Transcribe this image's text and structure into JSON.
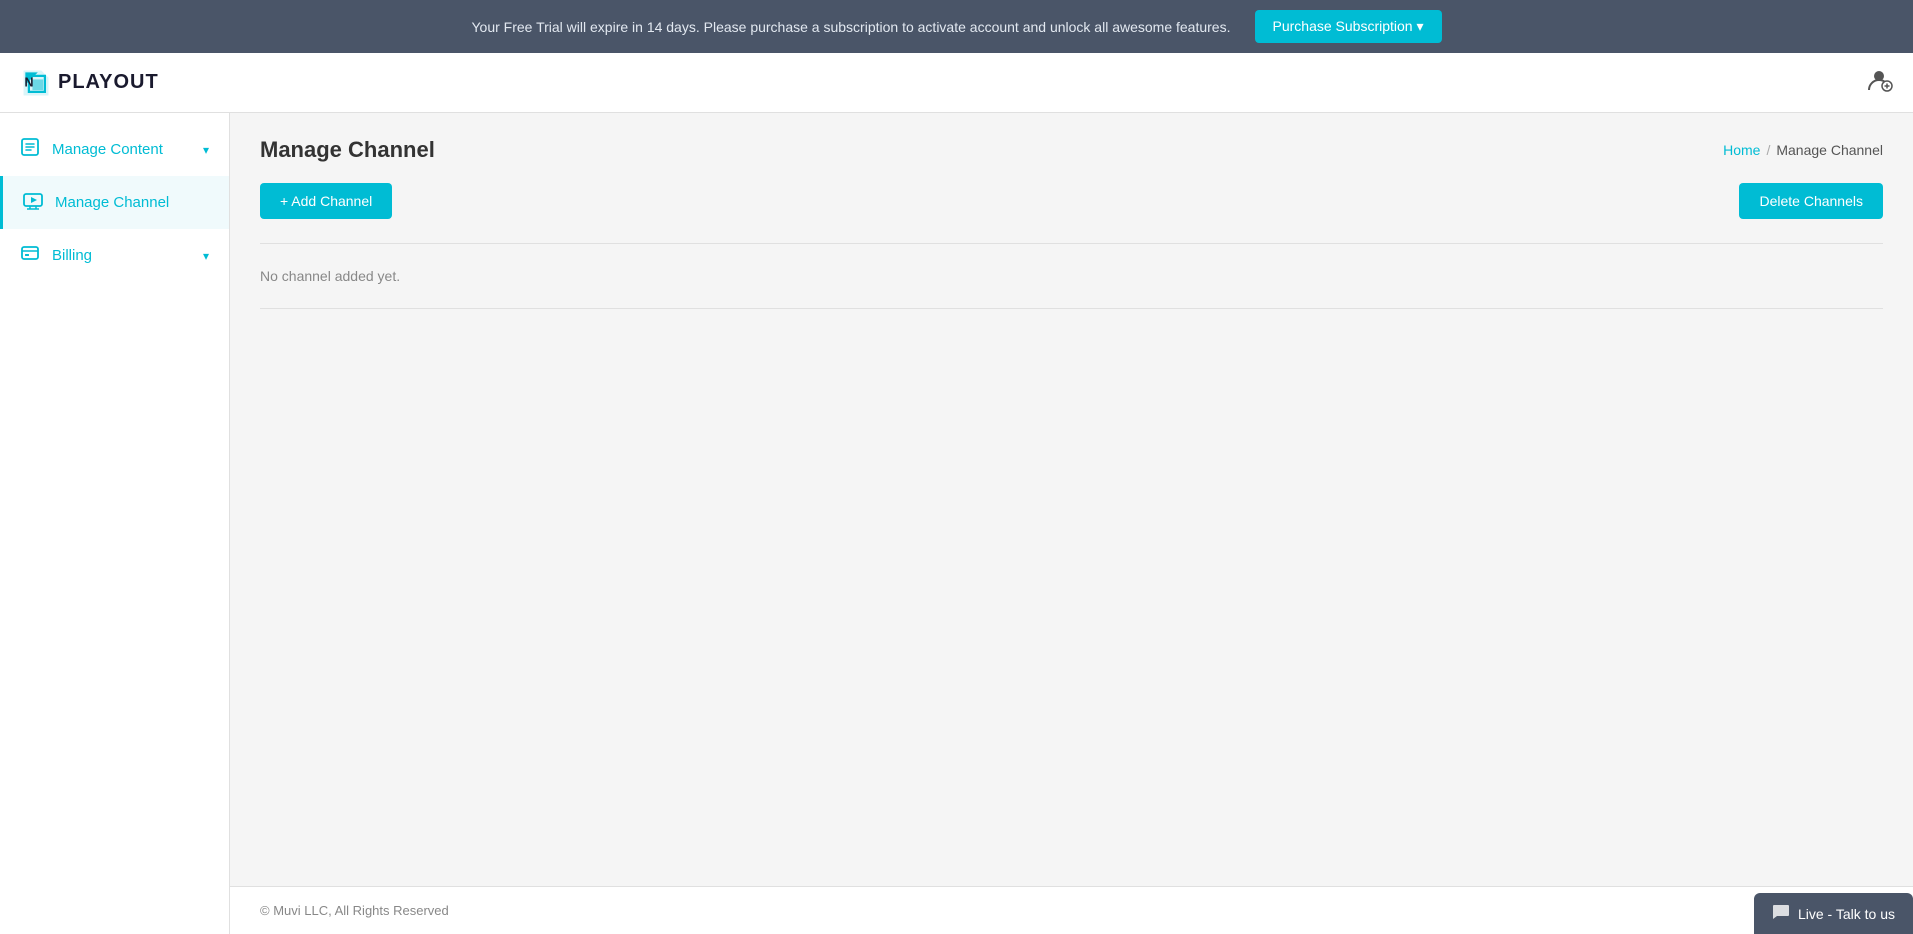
{
  "banner": {
    "message": "Your Free Trial will expire in 14 days. Please purchase a subscription to activate account and unlock all awesome features.",
    "purchase_button_label": "Purchase Subscription ▾"
  },
  "navbar": {
    "logo_text": "PLAYOUT",
    "user_icon": "👤"
  },
  "sidebar": {
    "items": [
      {
        "id": "manage-content",
        "label": "Manage Content",
        "icon": "🎓",
        "has_chevron": true,
        "active": false
      },
      {
        "id": "manage-channel",
        "label": "Manage Channel",
        "icon": "📺",
        "has_chevron": false,
        "active": true
      },
      {
        "id": "billing",
        "label": "Billing",
        "icon": "🧾",
        "has_chevron": true,
        "active": false
      }
    ]
  },
  "page": {
    "title": "Manage Channel",
    "breadcrumb_home": "Home",
    "breadcrumb_separator": "/",
    "breadcrumb_current": "Manage Channel",
    "add_channel_label": "+ Add Channel",
    "delete_channels_label": "Delete Channels",
    "empty_message": "No channel added yet."
  },
  "footer": {
    "copyright": "© Muvi LLC, All Rights Reserved"
  },
  "live_chat": {
    "label": "Live - Talk to us",
    "icon": "💬"
  }
}
